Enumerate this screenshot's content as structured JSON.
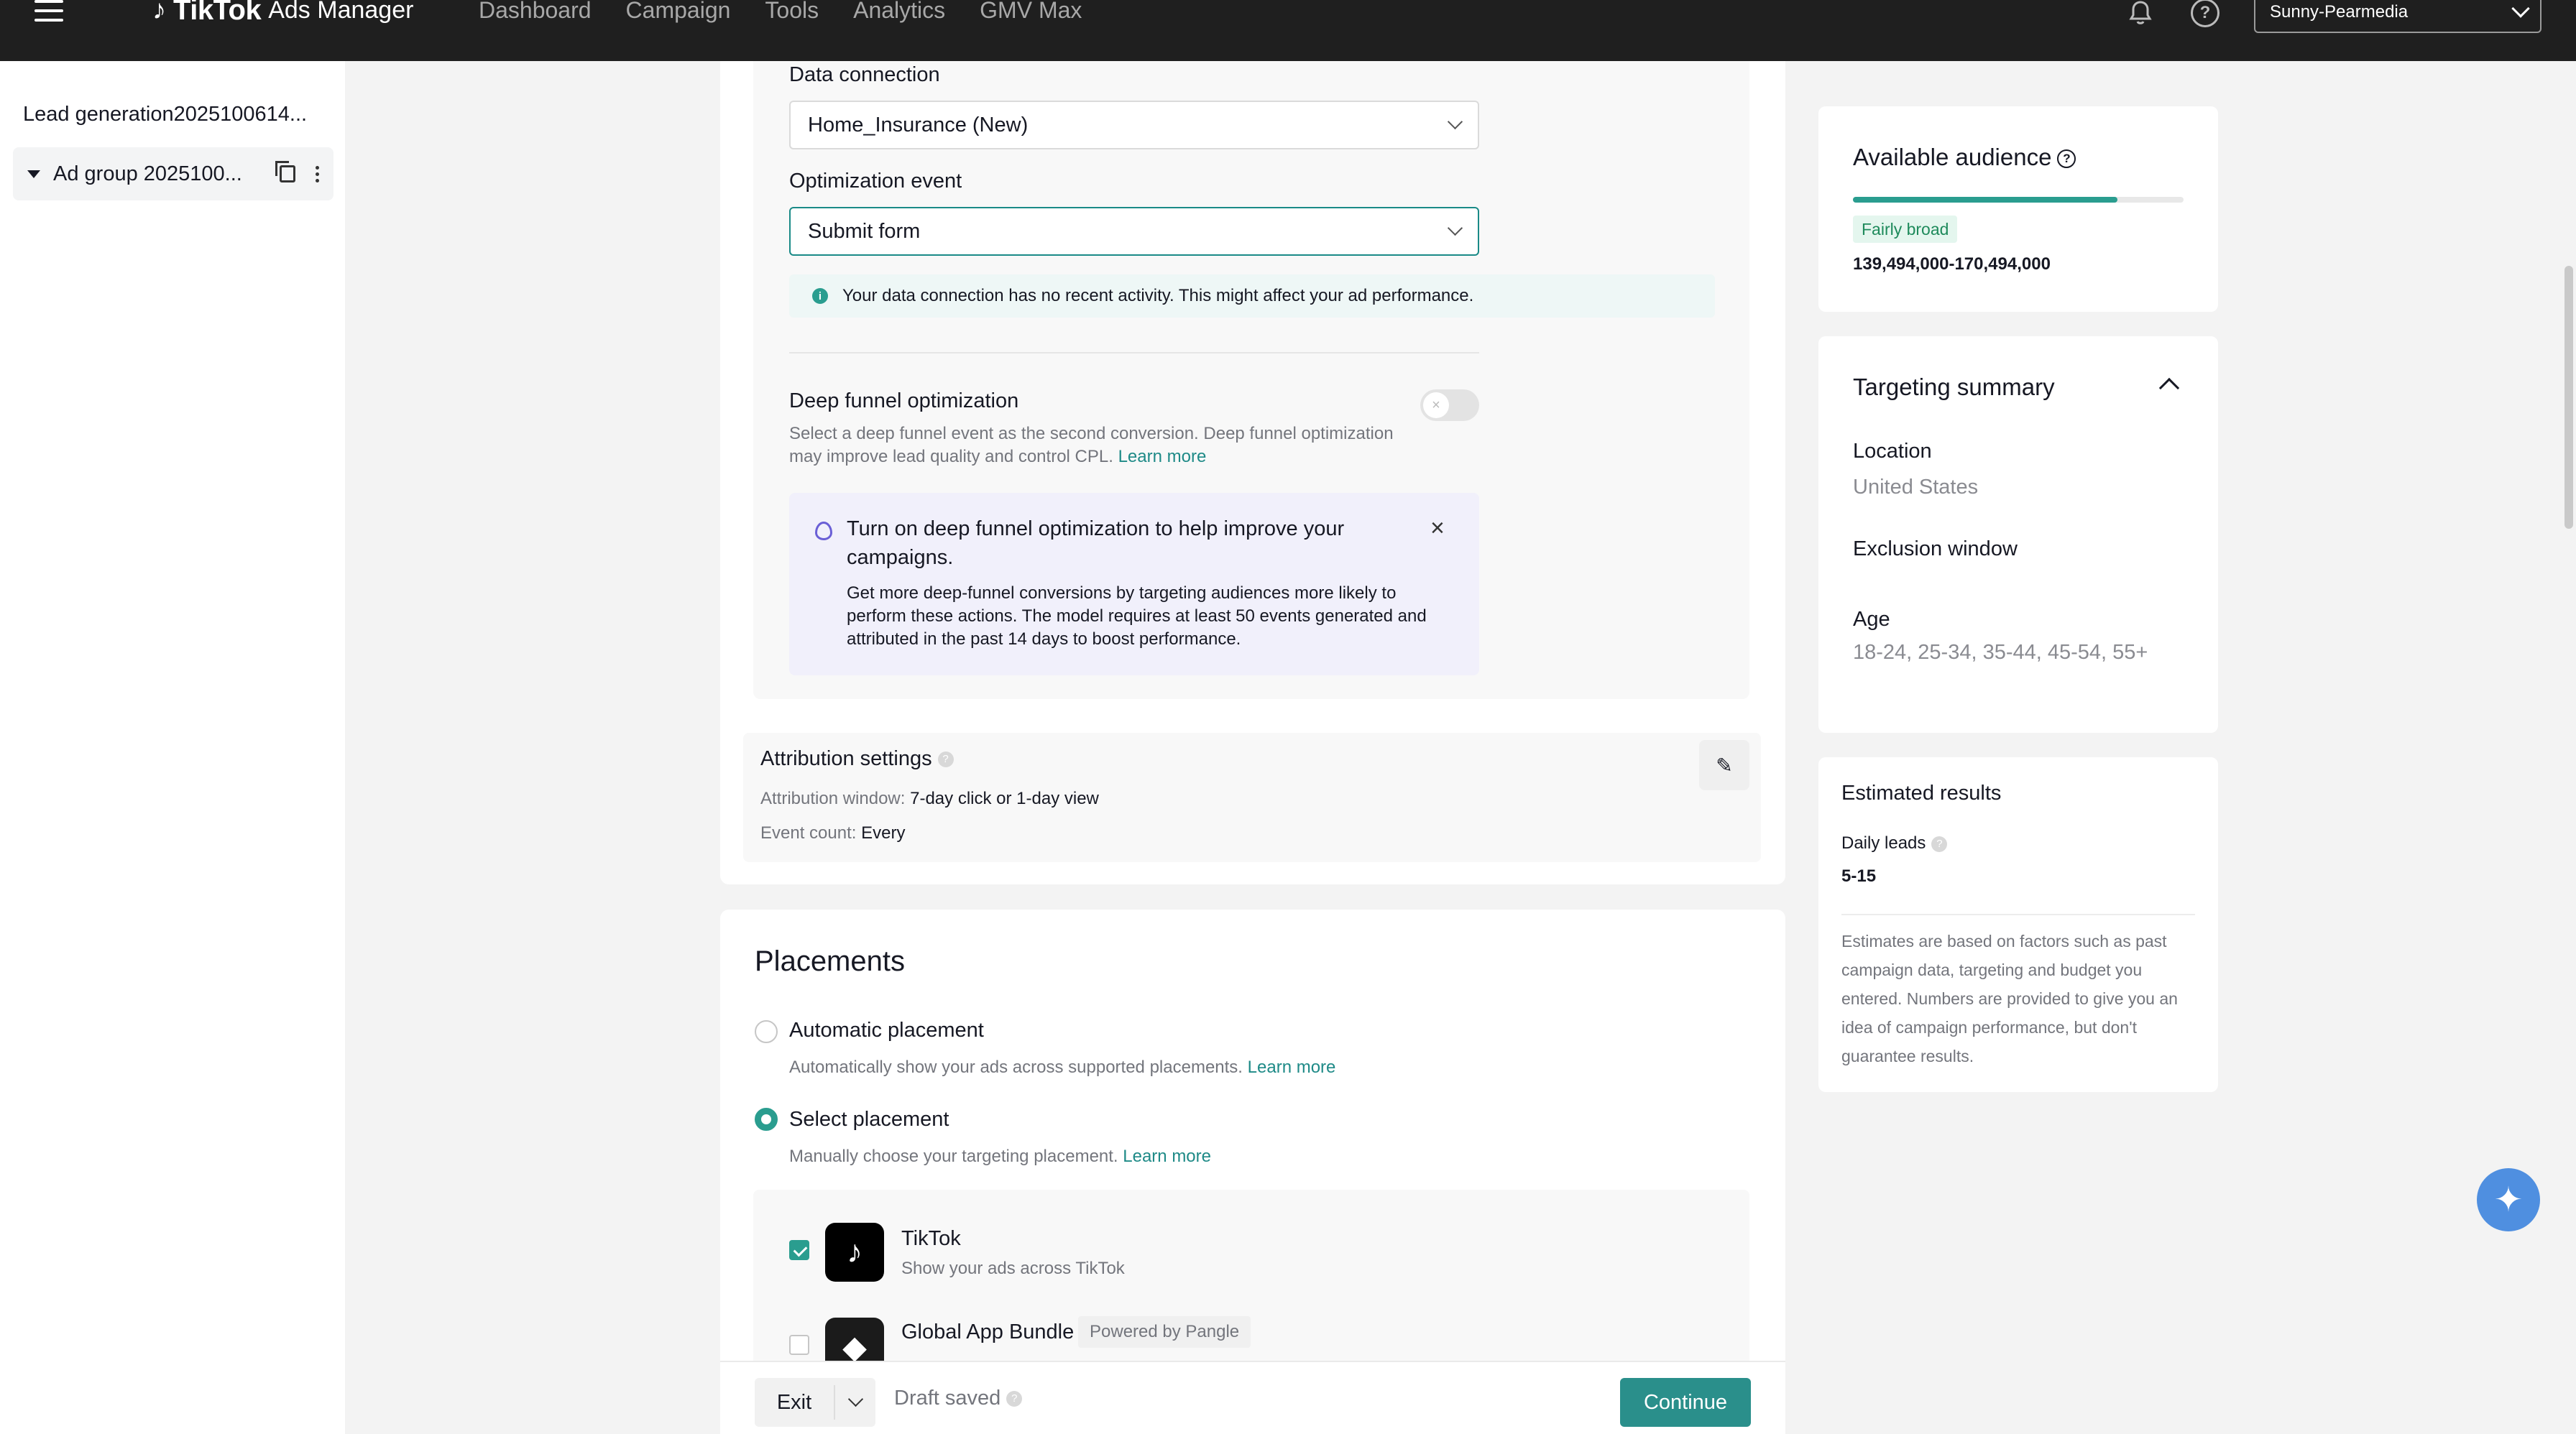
{
  "topnav": {
    "logo_brand": "TikTok",
    "logo_sub": "Ads Manager",
    "items": [
      "Dashboard",
      "Campaign",
      "Tools",
      "Analytics",
      "GMV Max"
    ],
    "account": "Sunny-Pearmedia"
  },
  "sidebar": {
    "campaign": "Lead generation2025100614...",
    "adgroup": "Ad group 2025100..."
  },
  "optimization": {
    "data_connection_label": "Data connection",
    "data_connection_value": "Home_Insurance (New)",
    "optimization_event_label": "Optimization event",
    "optimization_event_value": "Submit form",
    "info_text": "Your data connection has no recent activity. This might affect your ad performance.",
    "deep_funnel_title": "Deep funnel optimization",
    "deep_funnel_desc": "Select a deep funnel event as the second conversion. Deep funnel optimization may improve lead quality and control CPL.",
    "learn_more": "Learn more",
    "promo_title": "Turn on deep funnel optimization to help improve your campaigns.",
    "promo_body": "Get more deep-funnel conversions by targeting audiences more likely to perform these actions. The model requires at least 50 events generated and attributed in the past 14 days to boost performance."
  },
  "attribution": {
    "title": "Attribution settings",
    "window_label": "Attribution window:",
    "window_value": "7-day click or 1-day view",
    "count_label": "Event count:",
    "count_value": "Every"
  },
  "placements": {
    "title": "Placements",
    "auto_label": "Automatic placement",
    "auto_desc": "Automatically show your ads across supported placements.",
    "select_label": "Select placement",
    "select_desc": "Manually choose your targeting placement.",
    "learn_more": "Learn more",
    "tiktok_name": "TikTok",
    "tiktok_desc": "Show your ads across TikTok",
    "gab_name": "Global App Bundle",
    "gab_badge": "Powered by Pangle"
  },
  "bottom": {
    "exit": "Exit",
    "draft": "Draft saved",
    "continue": "Continue"
  },
  "audience": {
    "title": "Available audience",
    "badge": "Fairly broad",
    "range": "139,494,000-170,494,000",
    "fill_fraction": 0.8
  },
  "targeting": {
    "title": "Targeting summary",
    "location_label": "Location",
    "location_value": "United States",
    "exclusion_label": "Exclusion window",
    "age_label": "Age",
    "age_value": "18-24, 25-34, 35-44, 45-54, 55+"
  },
  "estimated": {
    "title": "Estimated results",
    "daily_leads_label": "Daily leads",
    "daily_leads_value": "5-15",
    "note": "Estimates are based on factors such as past campaign data, targeting and budget you entered. Numbers are provided to give you an idea of campaign performance, but don't guarantee results."
  },
  "colors": {
    "accent": "#2a9d8f",
    "nav_bg": "#1f1f1f",
    "link": "#1e8a87"
  }
}
